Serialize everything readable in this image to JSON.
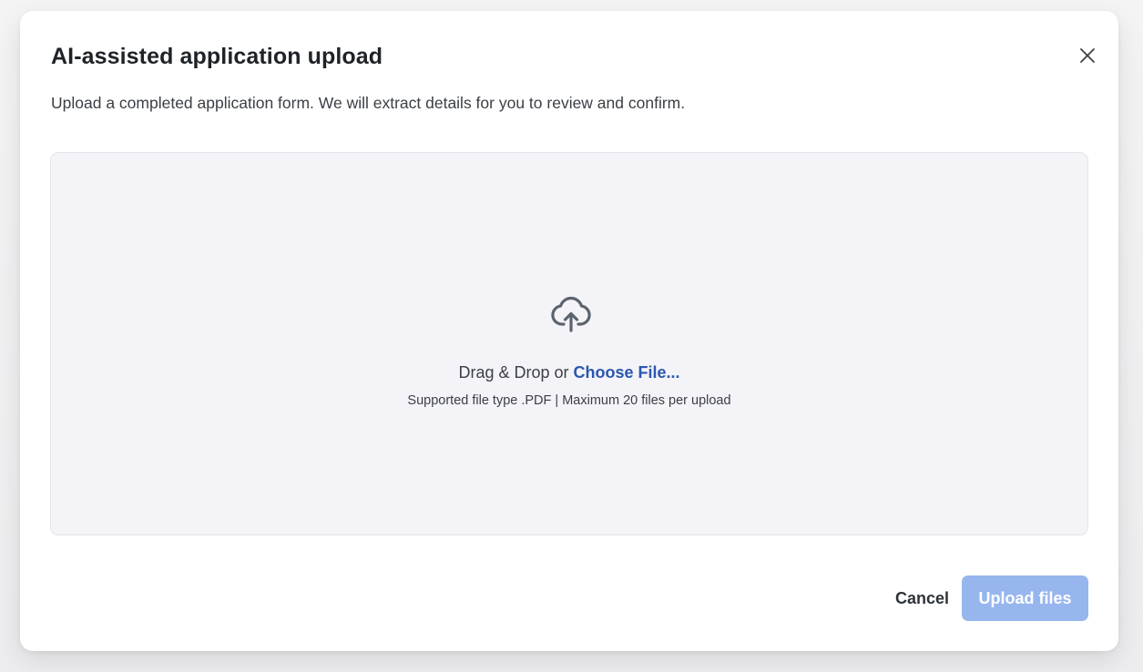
{
  "dialog": {
    "title": "AI-assisted application upload",
    "subtitle": "Upload a completed application form. We will extract details for you to review and confirm.",
    "close_icon": "close-icon"
  },
  "dropzone": {
    "icon": "cloud-upload-icon",
    "drag_text": "Drag & Drop or ",
    "choose_file_label": "Choose File...",
    "hint": "Supported file type .PDF | Maximum 20 files per upload"
  },
  "footer": {
    "cancel_label": "Cancel",
    "upload_label": "Upload files",
    "upload_disabled": true
  },
  "colors": {
    "link": "#2b57b0",
    "upload_button_disabled": "#97b6ee",
    "dropzone_bg": "#f4f4f8"
  }
}
